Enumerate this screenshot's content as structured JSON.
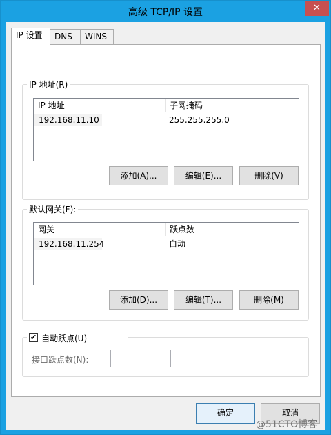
{
  "window": {
    "title": "高级 TCP/IP 设置",
    "close_glyph": "✕"
  },
  "tabs": [
    {
      "label": "IP 设置"
    },
    {
      "label": "DNS"
    },
    {
      "label": "WINS"
    }
  ],
  "ip_group": {
    "label": "IP 地址(R)",
    "columns": [
      "IP 地址",
      "子网掩码"
    ],
    "rows": [
      {
        "ip": "192.168.11.10",
        "mask": "255.255.255.0"
      }
    ],
    "buttons": {
      "add": "添加(A)...",
      "edit": "编辑(E)...",
      "delete": "删除(V)"
    }
  },
  "gateway_group": {
    "label": "默认网关(F):",
    "columns": [
      "网关",
      "跃点数"
    ],
    "rows": [
      {
        "gateway": "192.168.11.254",
        "metric": "自动"
      }
    ],
    "buttons": {
      "add": "添加(D)...",
      "edit": "编辑(T)...",
      "delete": "删除(M)"
    }
  },
  "auto_metric": {
    "checkbox_label": "自动跃点(U)",
    "checked": true,
    "check_glyph": "✔",
    "interface_metric_label": "接口跃点数(N):",
    "interface_metric_value": ""
  },
  "footer": {
    "ok": "确定",
    "cancel": "取消"
  },
  "watermark": "@51CTO博客",
  "colors": {
    "titlebar": "#1ba1e2",
    "close": "#c75050"
  }
}
